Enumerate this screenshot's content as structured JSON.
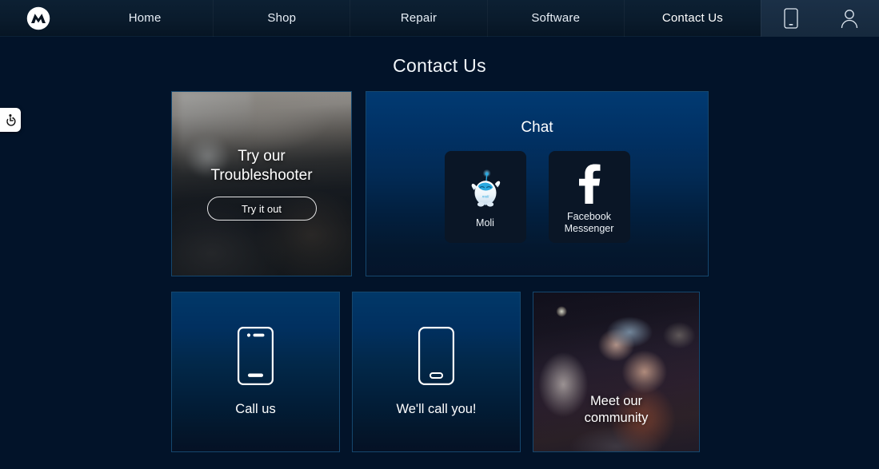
{
  "nav": {
    "logo_alt": "Motorola logo",
    "items": [
      {
        "label": "Home",
        "active": false
      },
      {
        "label": "Shop",
        "active": false
      },
      {
        "label": "Repair",
        "active": false
      },
      {
        "label": "Software",
        "active": false
      },
      {
        "label": "Contact Us",
        "active": true
      }
    ],
    "icons": [
      {
        "name": "device-phone-icon"
      },
      {
        "name": "user-account-icon"
      }
    ]
  },
  "accessibility": {
    "name": "accessibility-widget",
    "icon": "wheelchair-icon"
  },
  "page": {
    "title": "Contact Us"
  },
  "troubleshooter": {
    "title_line1": "Try our",
    "title_line2": "Troubleshooter",
    "button_label": "Try it out"
  },
  "chat": {
    "title": "Chat",
    "tiles": [
      {
        "label": "Moli",
        "icon": "moli-bot-icon",
        "label_line1": "Moli",
        "label_line2": ""
      },
      {
        "label": "Facebook Messenger",
        "icon": "facebook-f-icon",
        "label_line1": "Facebook",
        "label_line2": "Messenger"
      }
    ]
  },
  "options": [
    {
      "label": "Call us",
      "icon": "phone-call-icon"
    },
    {
      "label": "We'll call you!",
      "icon": "phone-callback-icon"
    }
  ],
  "community": {
    "label_line1": "Meet our",
    "label_line2": "community"
  },
  "colors": {
    "page_background": "#021329",
    "nav_background": "#0a1b2c",
    "card_border": "#15476e",
    "card_gradient_top": "#013a72",
    "card_gradient_bottom": "#05142a",
    "tile_background": "#0a1626",
    "accent_text": "#ffffff",
    "moli_blue": "#2aa9e0"
  }
}
